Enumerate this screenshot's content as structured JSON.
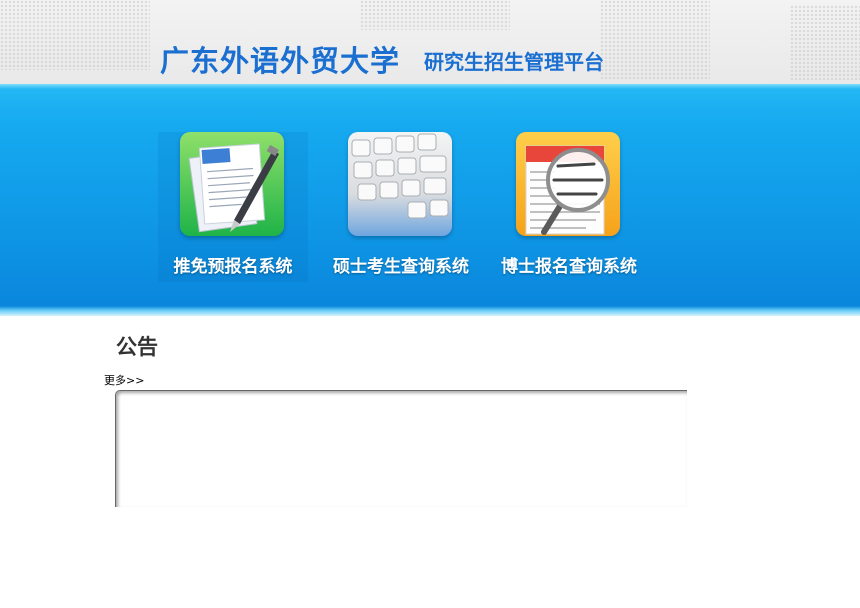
{
  "header": {
    "university": "广东外语外贸大学",
    "platform": "研究生招生管理平台"
  },
  "systems": [
    {
      "label": "推免预报名系统",
      "icon": "document-pen-icon",
      "active": true
    },
    {
      "label": "硕士考生查询系统",
      "icon": "keyboard-icon",
      "active": false
    },
    {
      "label": "博士报名查询系统",
      "icon": "magnifier-icon",
      "active": false
    }
  ],
  "notice": {
    "heading": "公告",
    "more": "更多>>"
  },
  "colors": {
    "title": "#1a6fd1",
    "band": "#16aaf0",
    "heading": "#333333"
  }
}
